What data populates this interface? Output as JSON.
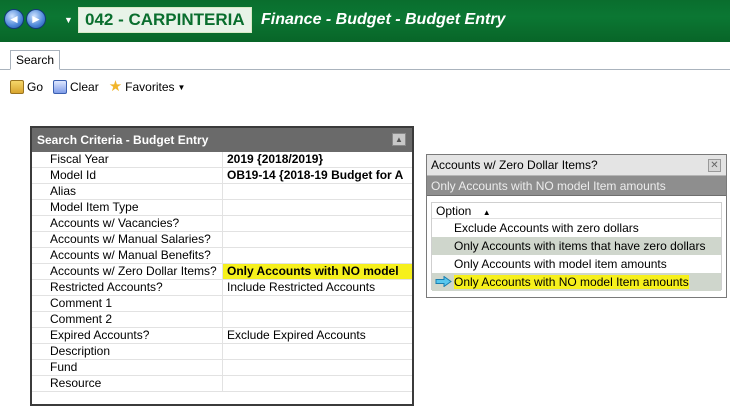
{
  "window": {
    "back_glyph": "◄",
    "forward_glyph": "►",
    "nav_dropdown_glyph": "▼",
    "site": "042 - CARPINTERIA",
    "title": "Finance - Budget - Budget Entry",
    "accent_color": "#0a6e2e"
  },
  "tabs": [
    {
      "label": "Search"
    }
  ],
  "toolbar": {
    "go_label": "Go",
    "clear_label": "Clear",
    "favorites_label": "Favorites",
    "favorites_caret": "▼",
    "icons": [
      "folder-go-icon",
      "clear-icon",
      "star-icon"
    ]
  },
  "search_criteria": {
    "title": "Search Criteria - Budget Entry",
    "collapse_glyph": "▲",
    "rows": [
      {
        "label": "Fiscal Year",
        "value": "2019 {2018/2019}"
      },
      {
        "label": "Model Id",
        "value": "OB19-14 {2018-19 Budget for A"
      },
      {
        "label": "Alias",
        "value": ""
      },
      {
        "label": "Model Item Type",
        "value": ""
      },
      {
        "label": "Accounts w/ Vacancies?",
        "value": ""
      },
      {
        "label": "Accounts w/ Manual Salaries?",
        "value": ""
      },
      {
        "label": "Accounts w/ Manual Benefits?",
        "value": ""
      },
      {
        "label": "Accounts w/ Zero Dollar Items?",
        "value": "Only Accounts with NO model"
      },
      {
        "label": "Restricted Accounts?",
        "value": "Include Restricted Accounts"
      },
      {
        "label": "Comment 1",
        "value": ""
      },
      {
        "label": "Comment 2",
        "value": ""
      },
      {
        "label": "Expired Accounts?",
        "value": "Exclude Expired Accounts"
      },
      {
        "label": "Description",
        "value": ""
      },
      {
        "label": "Fund",
        "value": ""
      },
      {
        "label": "Resource",
        "value": ""
      }
    ]
  },
  "dropdown": {
    "title": "Accounts w/ Zero Dollar Items?",
    "close_glyph": "✕",
    "current_value": "Only Accounts with NO model Item amounts",
    "column_header": "Option",
    "sort_glyph": "▲",
    "options": [
      {
        "label": "Exclude Accounts with zero dollars"
      },
      {
        "label": "Only Accounts with items that have zero dollars"
      },
      {
        "label": "Only Accounts with model item amounts"
      },
      {
        "label": "Only Accounts with NO model Item amounts"
      }
    ],
    "highlight_color": "#f6f01c"
  }
}
